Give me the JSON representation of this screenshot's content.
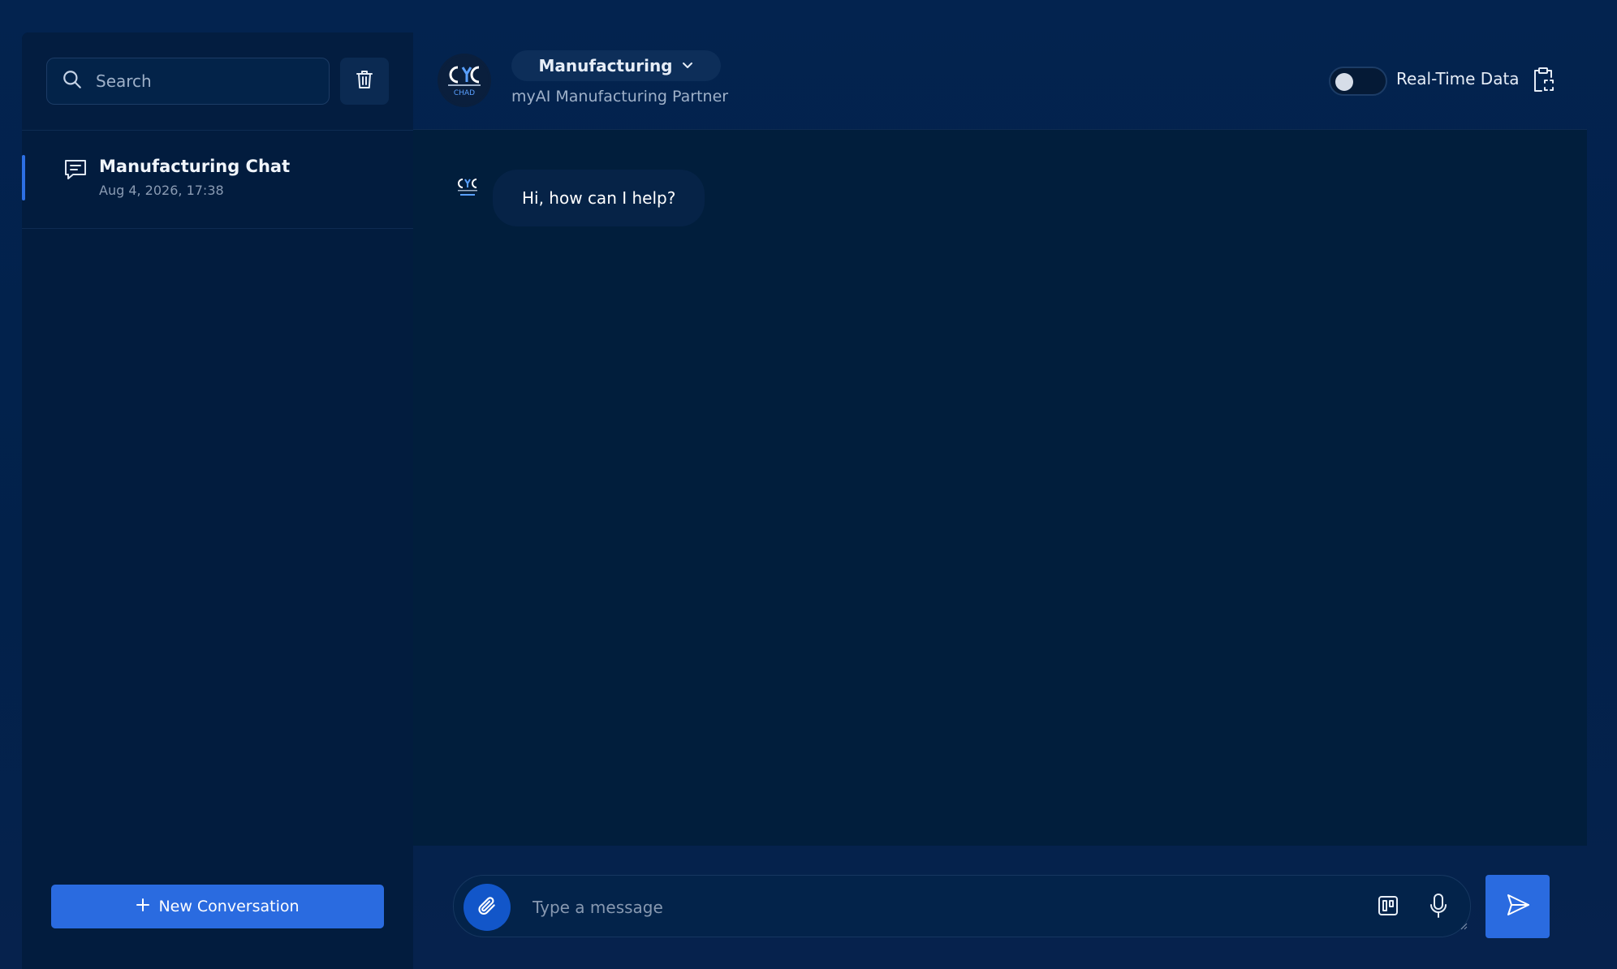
{
  "sidebar": {
    "search": {
      "placeholder": "Search"
    },
    "conversations": [
      {
        "title": "Manufacturing Chat",
        "date": "Aug 4, 2026, 17:38",
        "active": true
      }
    ],
    "new_conversation_label": "New Conversation"
  },
  "header": {
    "logo_text": "CHAD",
    "mode_label": "Manufacturing",
    "subtitle": "myAI Manufacturing Partner",
    "realtime_label": "Real-Time Data",
    "realtime_enabled": false
  },
  "messages": [
    {
      "role": "bot",
      "text": "Hi, how can I help?"
    }
  ],
  "composer": {
    "placeholder": "Type a message"
  },
  "icons": {
    "search": "search-icon",
    "trash": "trash-icon",
    "chat": "chat-bubble-icon",
    "plus": "plus-icon",
    "chevron": "chevron-down-icon",
    "clipboard": "clipboard-icon",
    "paperclip": "paperclip-icon",
    "template": "template-icon",
    "mic": "microphone-icon",
    "send": "send-icon"
  },
  "colors": {
    "accent": "#2a6be0",
    "background": "#021c3e",
    "panel": "#011e3c"
  }
}
